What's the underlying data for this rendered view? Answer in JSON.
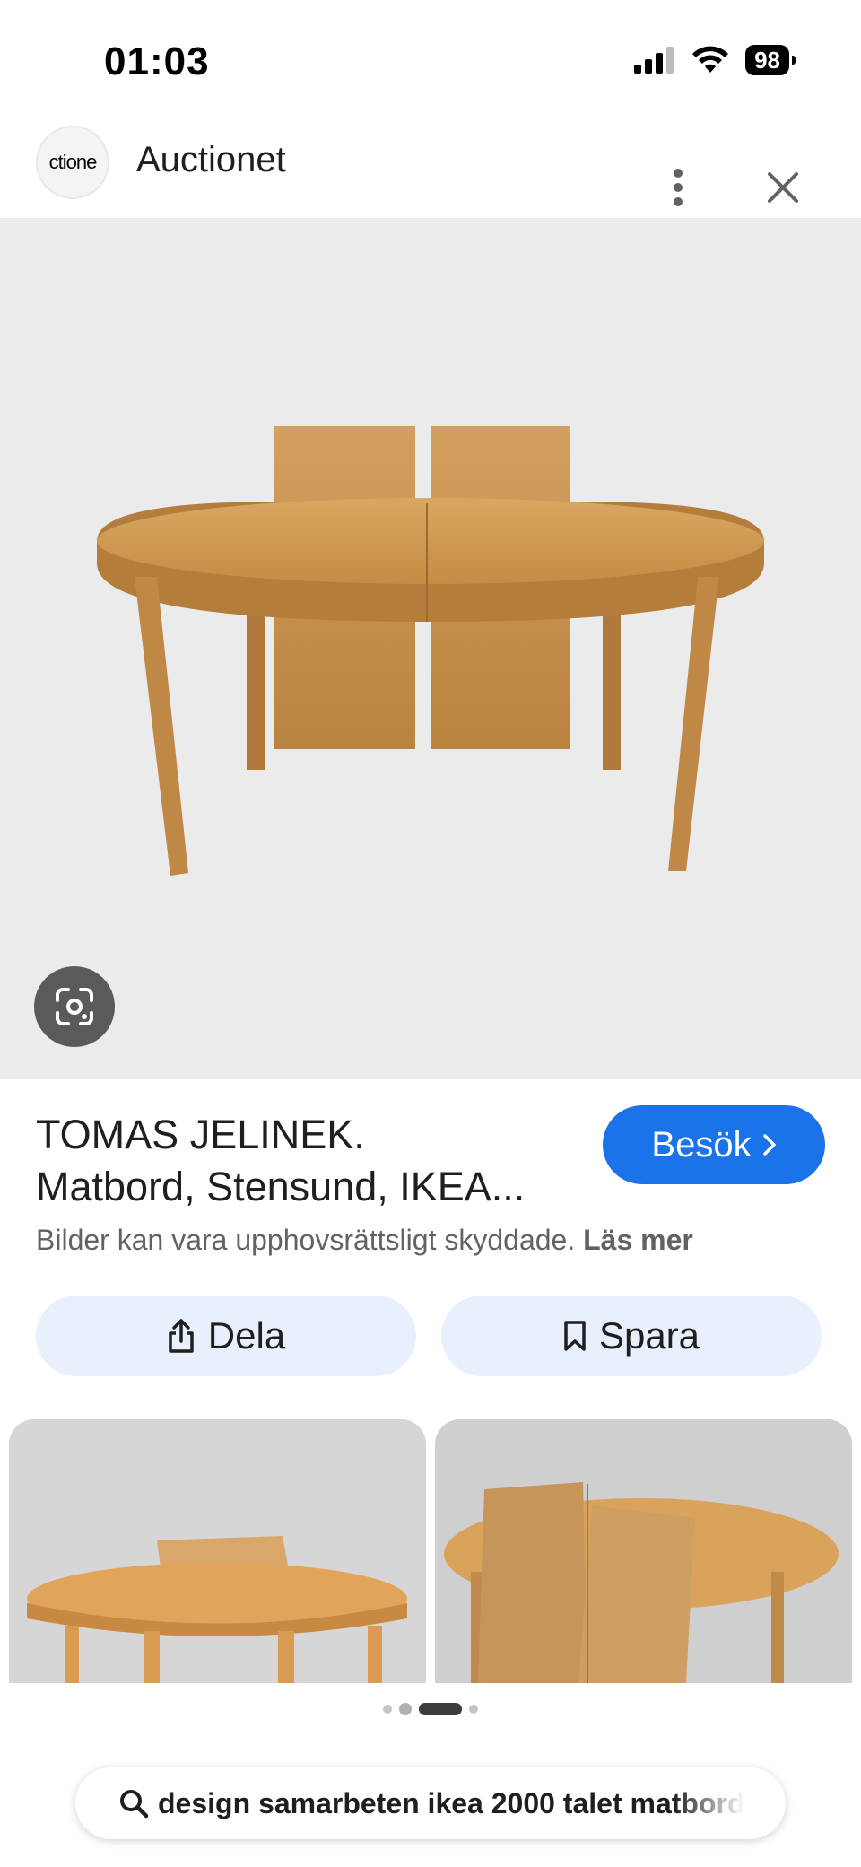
{
  "status_bar": {
    "time": "01:03",
    "battery": "98",
    "icons": [
      "cellular-signal-icon",
      "wifi-icon",
      "battery-icon"
    ]
  },
  "header": {
    "logo_text": "ctione",
    "site_name": "Auctionet",
    "more_icon": "more-vert-icon",
    "close_icon": "close-icon"
  },
  "hero": {
    "image_subject": "wooden oval dining table with two extension leaves",
    "lens_icon": "google-lens-icon"
  },
  "result": {
    "title_line1": "TOMAS JELINEK.",
    "title_line2": "Matbord, Stensund, IKEA...",
    "visit_label": "Besök",
    "visit_icon": "chevron-right-icon",
    "copyright_text": "Bilder kan vara upphovsrättsligt skyddade.",
    "copyright_link": "Läs mer"
  },
  "actions": {
    "share_label": "Dela",
    "share_icon": "share-icon",
    "save_label": "Spara",
    "save_icon": "bookmark-icon"
  },
  "related": {
    "thumbnails": [
      "table-with-leaves-on-top",
      "extension-leaves-closeup"
    ],
    "pager_dots": 4,
    "active_dot": 2
  },
  "search": {
    "icon": "search-icon",
    "query": "design samarbeten ikea 2000 talet matbord"
  },
  "colors": {
    "accent": "#1a73e8",
    "action_bg": "#e8effd",
    "hero_bg": "#ebebeb",
    "wood": "#c8944c"
  }
}
